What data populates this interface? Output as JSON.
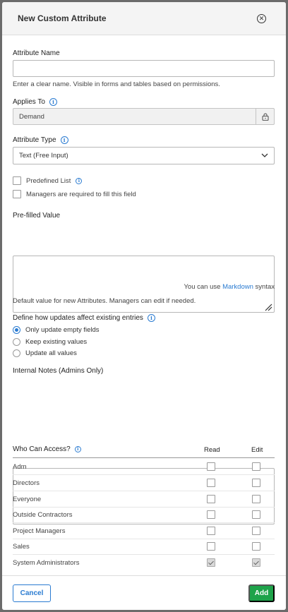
{
  "header": {
    "title": "New Custom Attribute"
  },
  "attribute_name": {
    "label": "Attribute Name",
    "value": "",
    "hint": "Enter a clear name. Visible in forms and tables based on permissions."
  },
  "applies_to": {
    "label": "Applies To",
    "value": "Demand"
  },
  "attribute_type": {
    "label": "Attribute Type",
    "selected": "Text (Free Input)"
  },
  "options": {
    "predefined_list": "Predefined List",
    "managers_required": "Managers are required to fill this field"
  },
  "prefilled": {
    "label": "Pre-filled Value",
    "value": "",
    "markdown_prefix": "You can use",
    "markdown_link": "Markdown",
    "markdown_suffix": "syntax",
    "hint": "Default value for new Attributes. Managers can edit if needed."
  },
  "updates": {
    "label": "Define how updates affect existing entries",
    "options": [
      "Only update empty fields",
      "Keep existing values",
      "Update all values"
    ],
    "selected": "Only update empty fields"
  },
  "internal_notes": {
    "label": "Internal Notes (Admins Only)",
    "value": ""
  },
  "access": {
    "label": "Who Can Access?",
    "read_header": "Read",
    "edit_header": "Edit",
    "rows": [
      {
        "name": "Adm",
        "read": false,
        "edit": false
      },
      {
        "name": "Directors",
        "read": false,
        "edit": false
      },
      {
        "name": "Everyone",
        "read": false,
        "edit": false
      },
      {
        "name": "Outside Contractors",
        "read": false,
        "edit": false
      },
      {
        "name": "Project Managers",
        "read": false,
        "edit": false
      },
      {
        "name": "Sales",
        "read": false,
        "edit": false
      },
      {
        "name": "System Administrators",
        "read": true,
        "edit": true
      }
    ]
  },
  "footer": {
    "cancel": "Cancel",
    "add": "Add"
  },
  "colors": {
    "accent": "#2a7bd1",
    "add_button": "#1ea34a"
  }
}
